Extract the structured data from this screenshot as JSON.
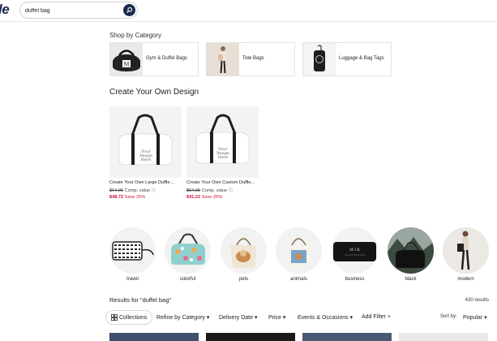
{
  "header": {
    "logo_text": "le",
    "search_value": "duffel bag"
  },
  "shop_by_category": {
    "title": "Shop by Category",
    "items": [
      {
        "label": "Gym & Duffel Bags"
      },
      {
        "label": "Tote Bags"
      },
      {
        "label": "Luggage & Bag Tags"
      }
    ]
  },
  "create_design": {
    "title": "Create Your Own Design",
    "products": [
      {
        "title": "Create Your Own Large Duffle...",
        "old_price": "$64.95",
        "comp": "Comp. value",
        "new_price": "$48.72",
        "save": "Save 25%",
        "image_text": "Your Image Here"
      },
      {
        "title": "Create Your Own Custom Duffle...",
        "old_price": "$54.95",
        "comp": "Comp. value",
        "new_price": "$41.22",
        "save": "Save 25%",
        "image_text": "Your Image Here"
      }
    ]
  },
  "styles": [
    {
      "label": "travel"
    },
    {
      "label": "colorful"
    },
    {
      "label": "pets"
    },
    {
      "label": "animals"
    },
    {
      "label": "business"
    },
    {
      "label": "black"
    },
    {
      "label": "modern"
    }
  ],
  "results": {
    "title": "Results for \"duffel bag\"",
    "count": "430 results"
  },
  "filters": {
    "collections": "Collections",
    "refine": "Refine by Category",
    "delivery": "Delivery Date",
    "price": "Price",
    "events": "Events & Occasions",
    "add_filter": "Add Filter",
    "sort_label": "Sort by:",
    "sort_value": "Popular"
  },
  "colors": {
    "brand": "#1b2b4f",
    "sale": "#d0103a"
  }
}
